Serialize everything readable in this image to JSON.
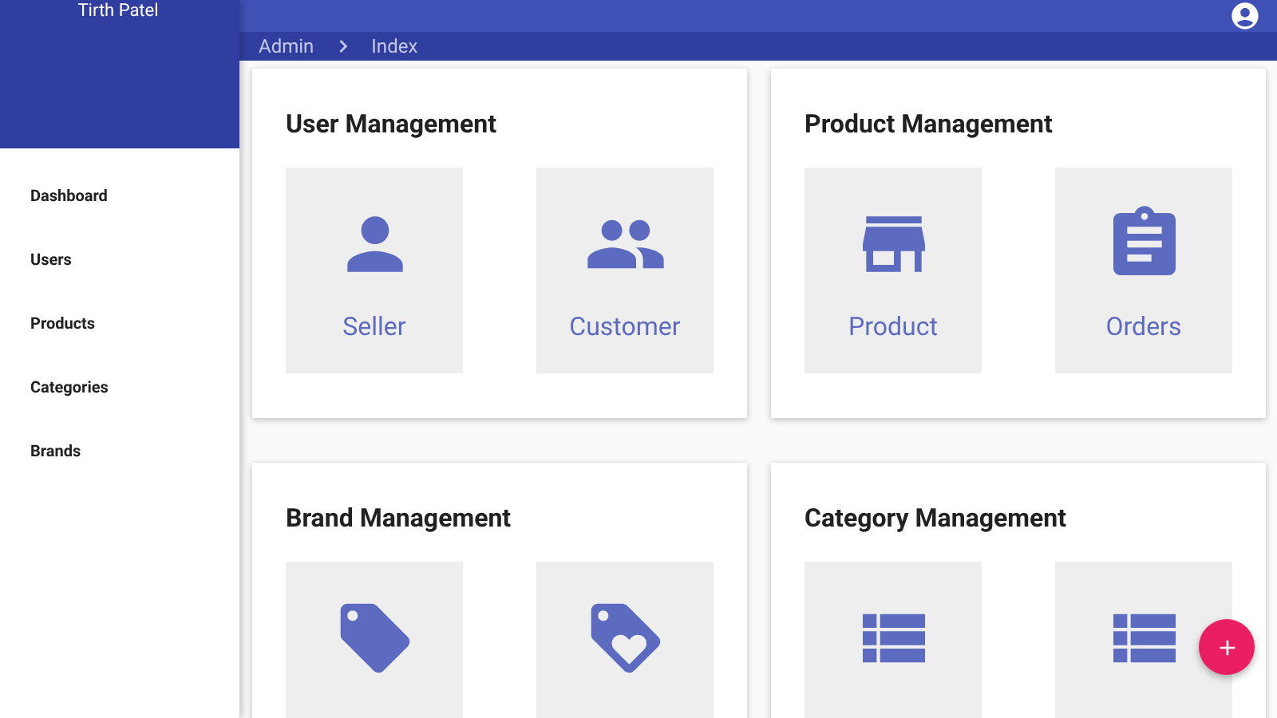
{
  "sidebar": {
    "user_name": "Tirth Patel",
    "items": [
      {
        "label": "Dashboard"
      },
      {
        "label": "Users"
      },
      {
        "label": "Products"
      },
      {
        "label": "Categories"
      },
      {
        "label": "Brands"
      }
    ]
  },
  "breadcrumb": [
    "Admin",
    "Index"
  ],
  "cards": [
    {
      "title": "User Management",
      "tiles": [
        {
          "kind": "person",
          "label": "Seller"
        },
        {
          "kind": "people",
          "label": "Customer"
        }
      ]
    },
    {
      "title": "Product Management",
      "tiles": [
        {
          "kind": "store",
          "label": "Product"
        },
        {
          "kind": "clipboard",
          "label": "Orders"
        }
      ]
    },
    {
      "title": "Brand Management",
      "tiles": [
        {
          "kind": "tag"
        },
        {
          "kind": "tag-heart"
        }
      ]
    },
    {
      "title": "Category Management",
      "tiles": [
        {
          "kind": "list"
        },
        {
          "kind": "list"
        }
      ]
    }
  ]
}
